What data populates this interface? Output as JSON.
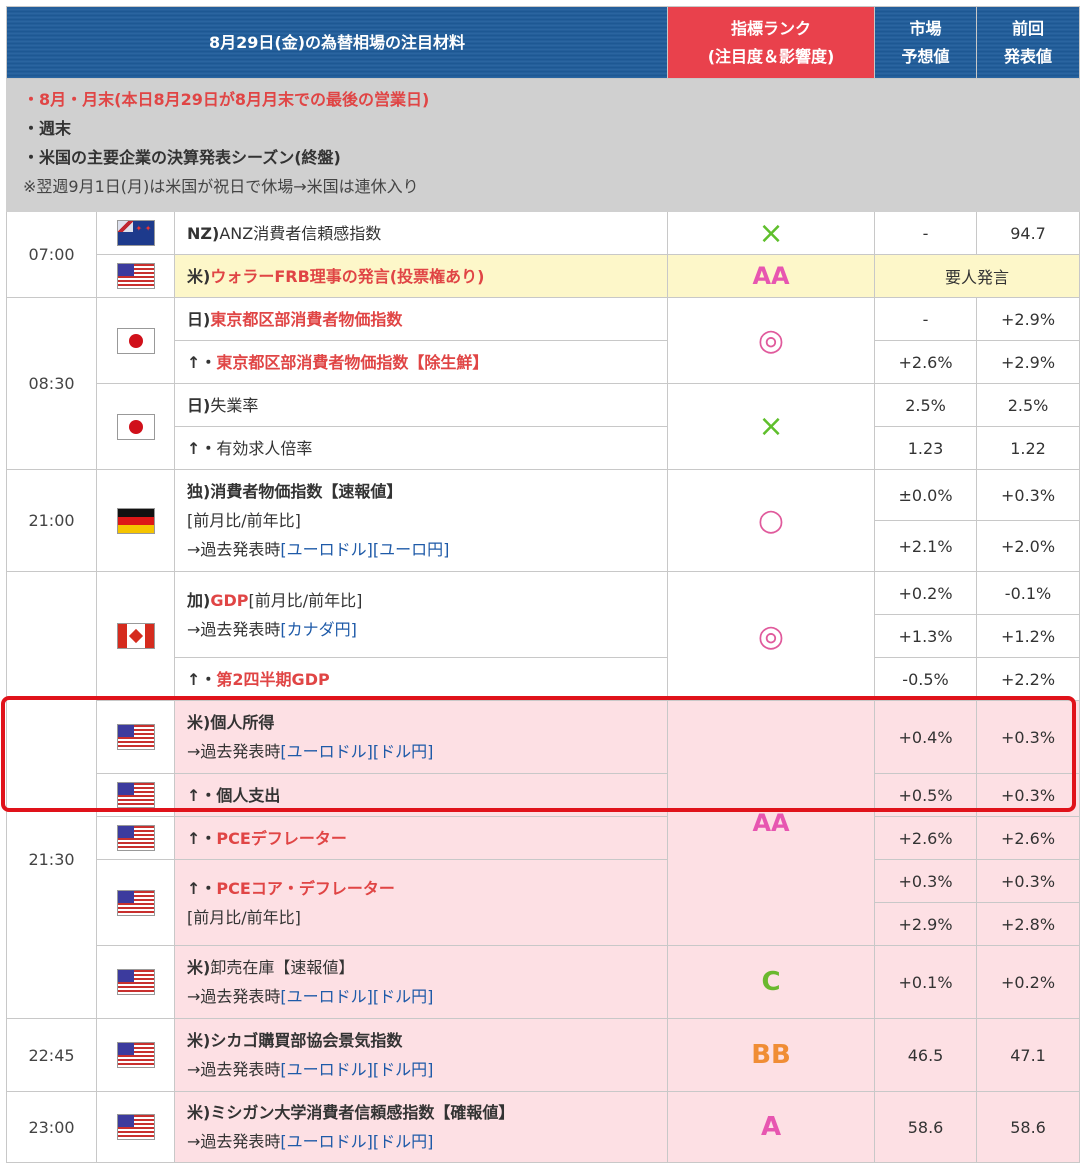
{
  "header": {
    "title": "8月29日(金)の為替相場の注目材料",
    "rank": "指標ランク",
    "rank_sub": "(注目度＆影響度)",
    "forecast_1": "市場",
    "forecast_2": "予想値",
    "previous_1": "前回",
    "previous_2": "発表値"
  },
  "notes": {
    "line1": "・8月・月末(本日8月29日が8月月末での最後の営業日)",
    "line2": "・週末",
    "line3": "・米国の主要企業の決算発表シーズン(終盤)",
    "line4": "※翌週9月1日(月)は米国が祝日で休場→米国は連休入り"
  },
  "colors": {
    "header_blue": "#1f5d9b",
    "rank_red": "#e9414c",
    "highlight_pink": "#fde0e4",
    "highlight_border": "#e0121a"
  },
  "times": {
    "t0700": "07:00",
    "t0830": "08:30",
    "t2100": "21:00",
    "t2130": "21:30",
    "t2245": "22:45",
    "t2300": "23:00"
  },
  "rows": {
    "nz_anz": {
      "prefix": "NZ)",
      "name": "ANZ消費者信頼感指数",
      "rank": "×",
      "forecast": "-",
      "previous": "94.7"
    },
    "us_waller": {
      "prefix": "米)",
      "name": "ウォラーFRB理事の発言(投票権あり)",
      "rank": "AA",
      "note": "要人発言"
    },
    "jp_tokyo_cpi": {
      "prefix": "日)",
      "name": "東京都区部消費者物価指数",
      "rank": "◎",
      "forecast": "-",
      "previous": "+2.9%"
    },
    "jp_tokyo_core": {
      "prefix": "↑・",
      "name": "東京都区部消費者物価指数【除生鮮】",
      "forecast": "+2.6%",
      "previous": "+2.9%"
    },
    "jp_unemp": {
      "prefix": "日)",
      "name": "失業率",
      "rank": "×",
      "forecast": "2.5%",
      "previous": "2.5%"
    },
    "jp_jobs": {
      "prefix": "↑・",
      "name": "有効求人倍率",
      "forecast": "1.23",
      "previous": "1.22"
    },
    "de_cpi": {
      "prefix": "独)",
      "name": "消費者物価指数【速報値】",
      "sub": "[前月比/前年比]",
      "past": "→過去発表時",
      "link1": "[ユーロドル]",
      "link2": "[ユーロ円]",
      "rank": "○",
      "forecast1": "±0.0%",
      "previous1": "+0.3%",
      "forecast2": "+2.1%",
      "previous2": "+2.0%"
    },
    "ca_gdp": {
      "prefix": "加)",
      "name": "GDP",
      "sub": "[前月比/前年比]",
      "past": "→過去発表時",
      "link1": "[カナダ円]",
      "rank": "◎",
      "forecast1": "+0.2%",
      "previous1": "-0.1%",
      "forecast2": "+1.3%",
      "previous2": "+1.2%"
    },
    "ca_q2": {
      "prefix": "↑・",
      "name": "第2四半期GDP",
      "forecast": "-0.5%",
      "previous": "+2.2%"
    },
    "us_income": {
      "prefix": "米)",
      "name": "個人所得",
      "past": "→過去発表時",
      "link1": "[ユーロドル]",
      "link2": "[ドル円]",
      "forecast": "+0.4%",
      "previous": "+0.3%"
    },
    "us_spending": {
      "prefix": "↑・",
      "name": "個人支出",
      "forecast": "+0.5%",
      "previous": "+0.3%"
    },
    "us_pce": {
      "prefix": "↑・",
      "name": "PCEデフレーター",
      "rank": "AA",
      "forecast": "+2.6%",
      "previous": "+2.6%"
    },
    "us_core_pce": {
      "prefix": "↑・",
      "name": "PCEコア・デフレーター",
      "sub": "[前月比/前年比]",
      "forecast1": "+0.3%",
      "previous1": "+0.3%",
      "forecast2": "+2.9%",
      "previous2": "+2.8%"
    },
    "us_wholesale": {
      "prefix": "米)",
      "name": "卸売在庫【速報値】",
      "past": "→過去発表時",
      "link1": "[ユーロドル]",
      "link2": "[ドル円]",
      "rank": "C",
      "forecast": "+0.1%",
      "previous": "+0.2%"
    },
    "us_chicago": {
      "prefix": "米)",
      "name": "シカゴ購買部協会景気指数",
      "past": "→過去発表時",
      "link1": "[ユーロドル]",
      "link2": "[ドル円]",
      "rank": "BB",
      "forecast": "46.5",
      "previous": "47.1"
    },
    "us_michigan": {
      "prefix": "米)",
      "name": "ミシガン大学消費者信頼感指数【確報値】",
      "past": "→過去発表時",
      "link1": "[ユーロドル]",
      "link2": "[ドル円]",
      "rank": "A",
      "forecast": "58.6",
      "previous": "58.6"
    }
  },
  "flags": {
    "nz": "nz-flag-icon",
    "us": "us-flag-icon",
    "jp": "jp-flag-icon",
    "de": "de-flag-icon",
    "ca": "ca-flag-icon"
  }
}
